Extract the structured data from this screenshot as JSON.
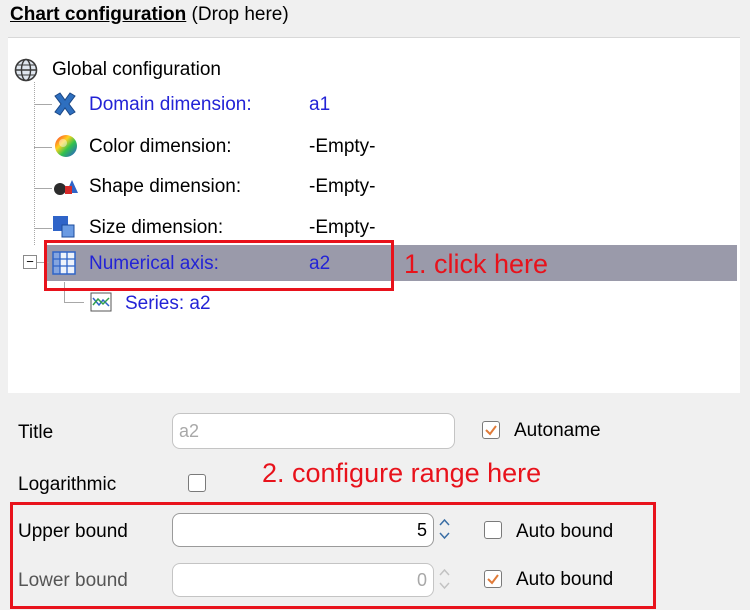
{
  "header": {
    "title_bold": "Chart configuration",
    "title_hint": " (Drop here)"
  },
  "tree": {
    "root_label": "Global configuration",
    "domain": {
      "label": "Domain dimension:",
      "value": "a1"
    },
    "color": {
      "label": "Color dimension:",
      "value": "-Empty-"
    },
    "shape": {
      "label": "Shape dimension:",
      "value": "-Empty-"
    },
    "size": {
      "label": "Size dimension:",
      "value": "-Empty-"
    },
    "axis": {
      "label": "Numerical axis:",
      "value": "a2",
      "expander": "−"
    },
    "series": {
      "label": "Series: a2"
    }
  },
  "annotations": {
    "step1": "1. click here",
    "step2": "2. configure range here"
  },
  "form": {
    "title_label": "Title",
    "title_value": "a2",
    "autoname_label": "Autoname",
    "autoname_checked": true,
    "logarithmic_label": "Logarithmic",
    "logarithmic_checked": false,
    "upper_label": "Upper bound",
    "upper_value": "5",
    "upper_auto_label": "Auto bound",
    "upper_auto_checked": false,
    "lower_label": "Lower bound",
    "lower_value": "0",
    "lower_auto_label": "Auto bound",
    "lower_auto_checked": true
  },
  "colors": {
    "annotation_red": "#e8121b",
    "link_blue": "#2323d6",
    "selection": "#9a9aaa",
    "check_orange": "#e07b39"
  },
  "icons": [
    "globe-icon",
    "cross-icon",
    "color-wheel-icon",
    "shapes-icon",
    "size-icon",
    "grid-axis-icon",
    "series-icon",
    "spin-up-icon",
    "spin-down-icon"
  ]
}
